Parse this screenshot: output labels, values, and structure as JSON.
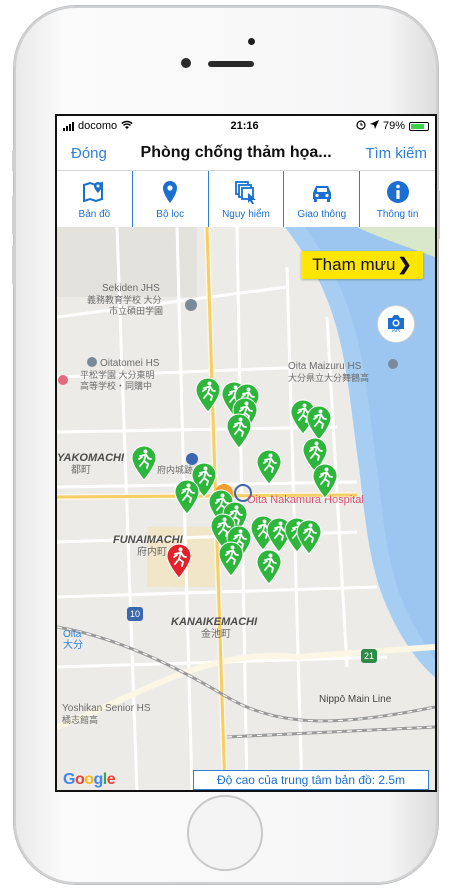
{
  "status": {
    "carrier": "docomo",
    "time": "21:16",
    "battery": "79%"
  },
  "navbar": {
    "close": "Đóng",
    "title": "Phòng chống thảm họa...",
    "search": "Tìm kiếm"
  },
  "toolbar": {
    "items": [
      {
        "label": "Bản đồ",
        "icon": "map-pin-icon"
      },
      {
        "label": "Bộ lọc",
        "icon": "location-pin-icon"
      },
      {
        "label": "Nguy hiểm",
        "icon": "layers-cursor-icon"
      },
      {
        "label": "Giao thông",
        "icon": "car-icon"
      },
      {
        "label": "Thông tin",
        "icon": "info-icon"
      }
    ]
  },
  "map": {
    "tham_muu": "Tham mưu",
    "camera_ar": "AR",
    "labels": {
      "sekiden_en": "Sekiden JHS",
      "sekiden_jp1": "義務教育学校 大分",
      "sekiden_jp2": "市立碩田学園",
      "oitatomei_en": "Oitatomei HS",
      "oitatomei_jp1": "平松学園 大分東明",
      "oitatomei_jp2": "高等学校・同購中",
      "maizuru_en": "Oita Maizuru HS",
      "maizuru_jp": "大分県立大分舞鶴高",
      "yakomachi": "YAKOMACHI",
      "yakomachi_jp": "都町",
      "funaimachi": "FUNAIMACHI",
      "funaimachi_jp": "府内町",
      "nakamura": "Oita Nakamura Hospital",
      "kanaikemachi": "KANAIKEMACHI",
      "kanaikemachi_jp": "金池町",
      "oita": "Oita",
      "oita_jp": "大分",
      "yoshikan_en": "Yoshikan Senior HS",
      "yoshikan_jp": "橘志館高",
      "nippo": "Nippō Main Line",
      "castle": "府内城跡",
      "route10": "10",
      "route21": "21"
    },
    "google": "Google",
    "elevation": "Độ cao của trung tâm bản đồ: 2.5m",
    "colors": {
      "pin_green": "#2db53c",
      "pin_red": "#e0232a",
      "river": "#a6cdf2"
    }
  }
}
